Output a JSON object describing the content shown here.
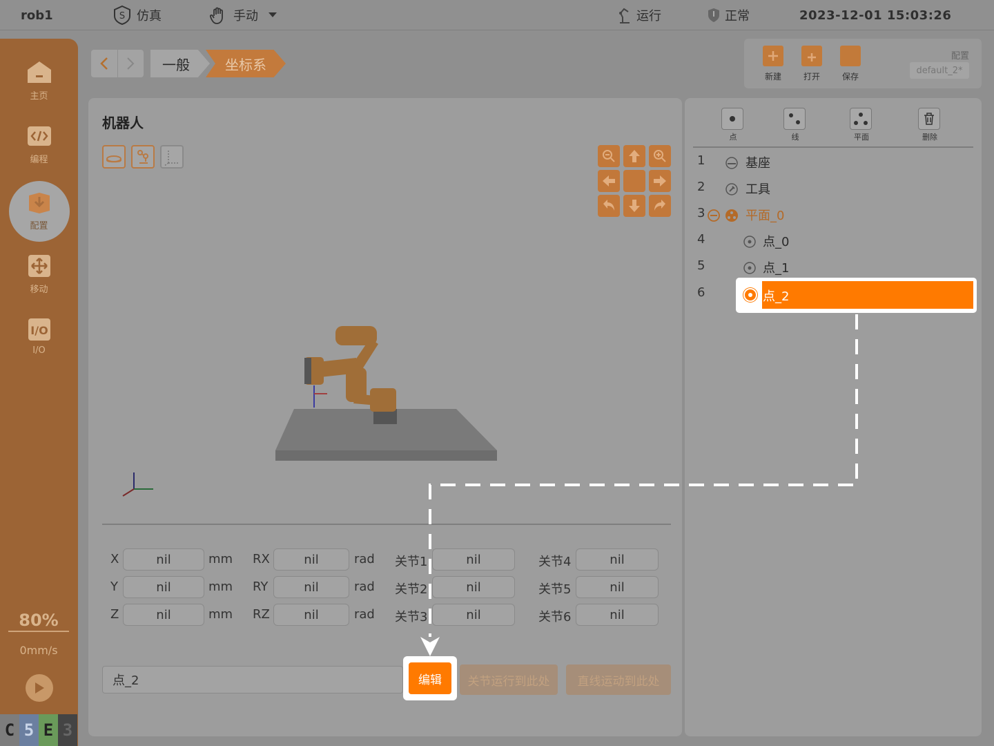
{
  "topbar": {
    "title": "rob1",
    "sim_label": "仿真",
    "mode_label": "手动",
    "run_label": "运行",
    "status_label": "正常",
    "datetime": "2023-12-01 15:03:26"
  },
  "sidebar": {
    "items": [
      {
        "label": "主页",
        "icon": "home-icon"
      },
      {
        "label": "编程",
        "icon": "code-icon"
      },
      {
        "label": "配置",
        "icon": "config-icon"
      },
      {
        "label": "移动",
        "icon": "move-icon"
      },
      {
        "label": "I/O",
        "icon": "io-icon"
      }
    ],
    "speed_percent": "80%",
    "velocity": "0mm/s",
    "status_letters": [
      "C",
      "5",
      "E",
      "3"
    ]
  },
  "breadcrumb": {
    "items": [
      "一般",
      "坐标系"
    ]
  },
  "config": {
    "new_label": "新建",
    "open_label": "打开",
    "save_label": "保存",
    "label": "配置",
    "name": "default_2*"
  },
  "robot_panel": {
    "title": "机器人",
    "fields": {
      "x_label": "X",
      "y_label": "Y",
      "z_label": "Z",
      "rx_label": "RX",
      "ry_label": "RY",
      "rz_label": "RZ",
      "x": "nil",
      "y": "nil",
      "z": "nil",
      "rx": "nil",
      "ry": "nil",
      "rz": "nil",
      "mm_unit": "mm",
      "rad_unit": "rad",
      "j1_label": "关节1",
      "j2_label": "关节2",
      "j3_label": "关节3",
      "j4_label": "关节4",
      "j5_label": "关节5",
      "j6_label": "关节6",
      "j1": "nil",
      "j2": "nil",
      "j3": "nil",
      "j4": "nil",
      "j5": "nil",
      "j6": "nil"
    },
    "point_name": "点_2",
    "edit_button": "编辑",
    "joint_move_button": "关节运行到此处",
    "linear_move_button": "直线运动到此处"
  },
  "tree": {
    "toolbar": {
      "point": "点",
      "line": "线",
      "plane": "平面",
      "delete": "删除"
    },
    "rows": [
      {
        "num": "1",
        "label": "基座"
      },
      {
        "num": "2",
        "label": "工具"
      },
      {
        "num": "3",
        "label": "平面_0"
      },
      {
        "num": "4",
        "label": "点_0"
      },
      {
        "num": "5",
        "label": "点_1"
      },
      {
        "num": "6",
        "label": "点_2"
      }
    ]
  },
  "colors": {
    "accent": "#ff7a00",
    "dimmed_accent": "#c2783a",
    "sidebar": "#9c6435"
  }
}
